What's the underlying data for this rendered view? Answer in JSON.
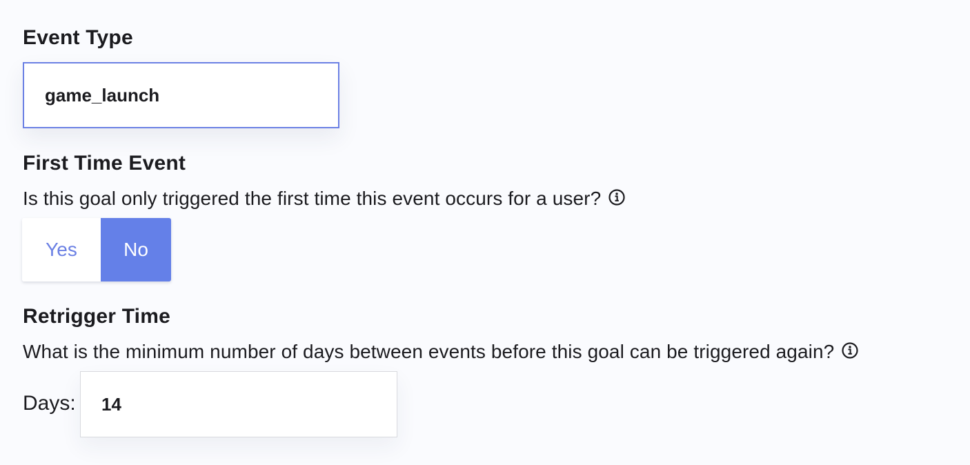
{
  "event_type": {
    "title": "Event Type",
    "value": "game_launch"
  },
  "first_time_event": {
    "title": "First Time Event",
    "description": "Is this goal only triggered the first time this event occurs for a user?",
    "info_icon": "info-circle-icon",
    "options": [
      "Yes",
      "No"
    ],
    "selected": "No"
  },
  "retrigger_time": {
    "title": "Retrigger Time",
    "description": "What is the minimum number of days between events before this goal can be triggered again?",
    "info_icon": "info-circle-icon",
    "days_label": "Days:",
    "days_value": "14"
  },
  "colors": {
    "accent": "#6480e8",
    "accent_text": "#6b80e4",
    "background": "#fafbfe"
  }
}
